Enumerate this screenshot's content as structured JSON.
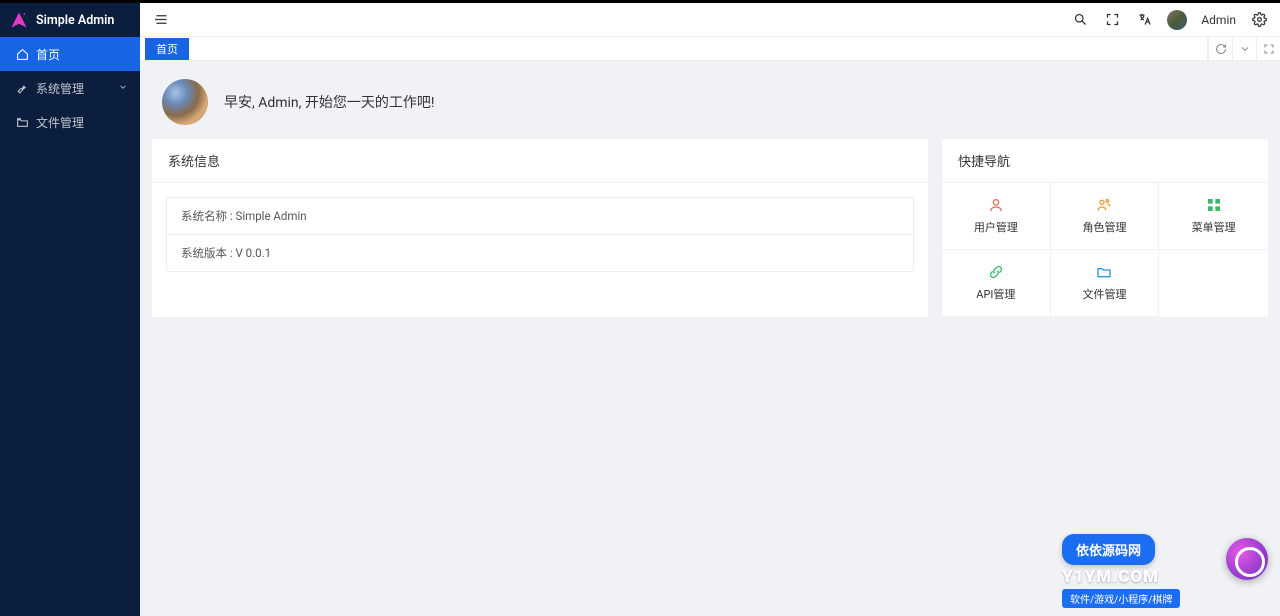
{
  "brand": {
    "name": "Simple Admin"
  },
  "sidebar": {
    "items": [
      {
        "label": "首页",
        "active": true,
        "icon": "home-icon"
      },
      {
        "label": "系统管理",
        "active": false,
        "icon": "wrench-icon",
        "expandable": true
      },
      {
        "label": "文件管理",
        "active": false,
        "icon": "folder-open-icon"
      }
    ]
  },
  "header": {
    "user_name": "Admin"
  },
  "tabs": {
    "items": [
      {
        "label": "首页",
        "active": true
      }
    ]
  },
  "greeting": {
    "text": "早安, Admin, 开始您一天的工作吧!"
  },
  "system_info": {
    "title": "系统信息",
    "rows": [
      "系统名称 : Simple Admin",
      "系统版本 : V 0.0.1"
    ]
  },
  "quick_nav": {
    "title": "快捷导航",
    "items": [
      {
        "label": "用户管理",
        "icon": "user-icon",
        "color": "#e86a5a"
      },
      {
        "label": "角色管理",
        "icon": "role-icon",
        "color": "#e89a3a"
      },
      {
        "label": "菜单管理",
        "icon": "grid-icon",
        "color": "#3ab86a"
      },
      {
        "label": "API管理",
        "icon": "api-icon",
        "color": "#3ab86a"
      },
      {
        "label": "文件管理",
        "icon": "folder-icon",
        "color": "#2a9adc"
      }
    ]
  },
  "watermark": {
    "line1": "依依源码网",
    "domain": "Y1YM.COM",
    "sub": "软件/游戏/小程序/棋牌"
  }
}
